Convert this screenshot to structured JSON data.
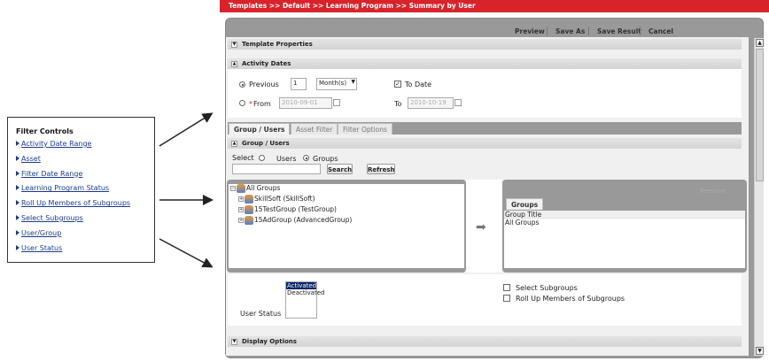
{
  "breadcrumb": "Templates >> Default >> Learning Program >> Summary by User",
  "toolbar": {
    "preview": "Preview",
    "save_as": "Save As",
    "save_result": "Save Result",
    "cancel": "Cancel"
  },
  "sections": {
    "template_properties": "Template Properties",
    "activity_dates": "Activity Dates",
    "group_users": "Group / Users",
    "display_options": "Display Options"
  },
  "activity_dates": {
    "previous_label": "Previous",
    "previous_value": "1",
    "unit": "Month(s)",
    "to_date_label": "To Date",
    "to_date_checked": true,
    "from_label": "From",
    "required_mark": "*",
    "from_value": "2010-09-01",
    "to_label": "To",
    "to_value": "2010-10-19",
    "selected": "previous"
  },
  "tabs": [
    {
      "label": "Group / Users",
      "active": true
    },
    {
      "label": "Asset Filter"
    },
    {
      "label": "Filter Options"
    }
  ],
  "group_users": {
    "select_label": "Select",
    "users_label": "Users",
    "groups_label": "Groups",
    "selected": "groups",
    "search_value": "",
    "search_button": "Search",
    "refresh_button": "Refresh"
  },
  "tree": [
    {
      "label": "All Groups"
    },
    {
      "label": "SkillSoft (SkillSoft)"
    },
    {
      "label": "15TestGroup (TestGroup)"
    },
    {
      "label": "15AdGroup (AdvancedGroup)"
    }
  ],
  "selected_pane": {
    "remove": "Remove",
    "tab": "Groups",
    "column": "Group Title",
    "rows": [
      "All Groups"
    ]
  },
  "user_status": {
    "label": "User Status",
    "options": [
      "Activated",
      "Deactivated"
    ],
    "selected": "Activated"
  },
  "options": {
    "select_subgroups": "Select Subgroups",
    "roll_up": "Roll Up Members of Subgroups"
  },
  "filter_controls": {
    "title": "Filter Controls",
    "items": [
      "Activity Date Range",
      "Asset",
      "Filter Date Range",
      "Learning Program Status",
      "Roll Up Members of Subgroups",
      "Select Subgroups",
      "User/Group",
      "User Status"
    ]
  },
  "colors": {
    "header": "#d8232a",
    "link": "#1a3c8c",
    "selection": "#0a246a"
  }
}
